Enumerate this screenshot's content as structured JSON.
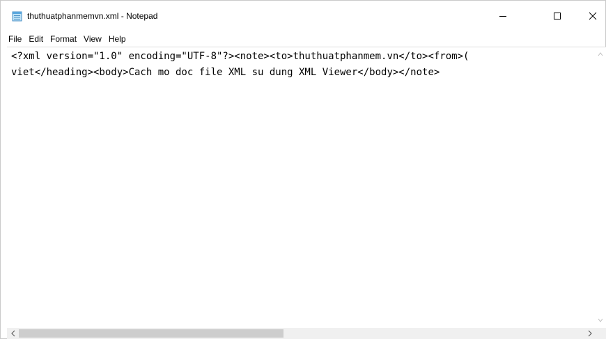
{
  "window": {
    "title": "thuthuatphanmemvn.xml - Notepad",
    "icon": "notepad-icon"
  },
  "caption_buttons": {
    "minimize_icon": "minimize-icon",
    "maximize_icon": "maximize-icon",
    "close_icon": "close-icon"
  },
  "menu": {
    "items": [
      {
        "label": "File"
      },
      {
        "label": "Edit"
      },
      {
        "label": "Format"
      },
      {
        "label": "View"
      },
      {
        "label": "Help"
      }
    ]
  },
  "editor": {
    "lines": [
      "<?xml version=\"1.0\" encoding=\"UTF-8\"?><note><to>thuthuatphanmem.vn</to><from>(",
      "viet</heading><body>Cach mo doc file XML su dung XML Viewer</body></note>"
    ]
  },
  "scrollbars": {
    "left_arrow": "chevron-left-icon",
    "right_arrow": "chevron-right-icon",
    "up_arrow": "chevron-up-icon",
    "down_arrow": "chevron-down-icon"
  },
  "colors": {
    "background": "#ffffff",
    "scrollbar_track": "#f0f0f0",
    "scrollbar_thumb": "#cdcdcd"
  }
}
